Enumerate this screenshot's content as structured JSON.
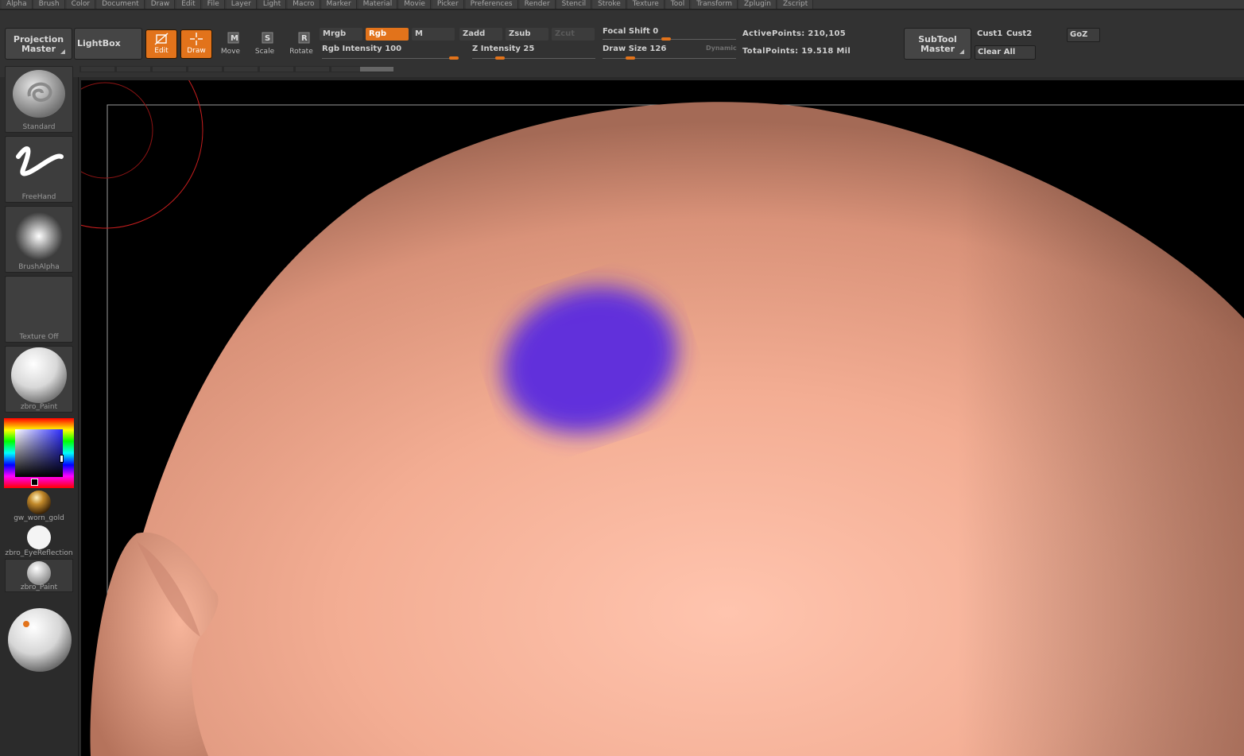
{
  "menu": [
    "Alpha",
    "Brush",
    "Color",
    "Document",
    "Draw",
    "Edit",
    "File",
    "Layer",
    "Light",
    "Macro",
    "Marker",
    "Material",
    "Movie",
    "Picker",
    "Preferences",
    "Render",
    "Stencil",
    "Stroke",
    "Texture",
    "Tool",
    "Transform",
    "Zplugin",
    "Zscript"
  ],
  "toolbar": {
    "projection_master": "Projection\nMaster",
    "lightbox": "LightBox",
    "edit": "Edit",
    "draw": "Draw",
    "move": "Move",
    "scale": "Scale",
    "rotate": "Rotate",
    "mrgb": "Mrgb",
    "rgb": "Rgb",
    "m": "M",
    "zadd": "Zadd",
    "zsub": "Zsub",
    "zcut": "Zcut",
    "rgb_intensity_label": "Rgb Intensity",
    "rgb_intensity_value": "100",
    "rgb_intensity_frac": 1.0,
    "z_intensity_label": "Z Intensity",
    "z_intensity_value": "25",
    "z_intensity_frac": 0.25,
    "focal_shift_label": "Focal Shift",
    "focal_shift_value": "0",
    "focal_shift_frac": 0.5,
    "draw_size_label": "Draw Size",
    "draw_size_value": "126",
    "draw_size_frac": 0.23,
    "dynamic": "Dynamic",
    "active_points_label": "ActivePoints:",
    "active_points_value": "210,105",
    "total_points_label": "TotalPoints:",
    "total_points_value": "19.518 Mil",
    "subtool_master": "SubTool\nMaster",
    "cust1": "Cust1",
    "cust2": "Cust2",
    "clear_all": "Clear All",
    "goz": "GoZ"
  },
  "left_shelf": {
    "brush": "Standard",
    "stroke": "FreeHand",
    "alpha": "BrushAlpha",
    "texture": "Texture Off",
    "material": "zbro_Paint",
    "mat2": "gw_worn_gold",
    "mat3": "zbro_EyeReflection",
    "mat4": "zbro_Paint"
  },
  "colors": {
    "accent": "#e2731b",
    "skin": "#f0ab93",
    "paint": "#5a2be0",
    "brush_ring": "#c81e1e"
  }
}
